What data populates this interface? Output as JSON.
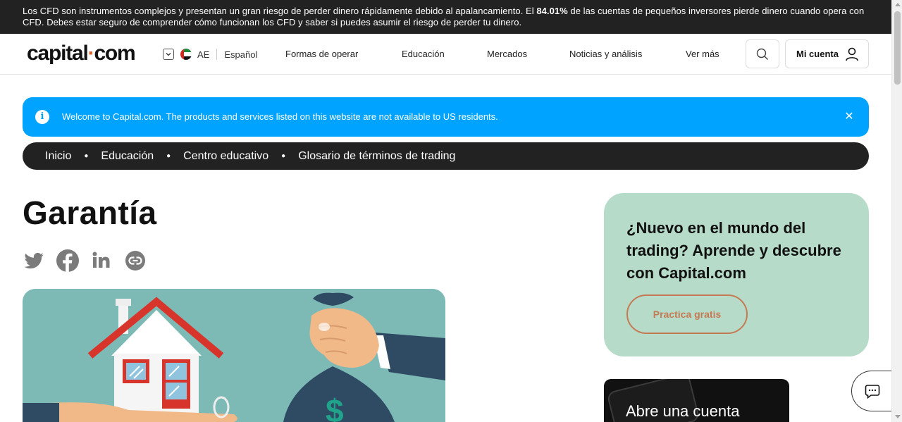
{
  "risk_warning": {
    "text_before": "Los CFD son instrumentos complejos y presentan un gran riesgo de perder dinero rápidamente debido al apalancamiento. El ",
    "percent": "84.01%",
    "text_after": " de las cuentas de pequeños inversores pierde dinero cuando opera con CFD. Debes estar seguro de comprender cómo funcionan los CFD y saber si puedes asumir el riesgo de perder tu dinero."
  },
  "header": {
    "logo_left": "capital",
    "logo_dot": "·",
    "logo_right": "com",
    "region": "AE",
    "language": "Español",
    "nav": [
      "Formas de operar",
      "Educación",
      "Mercados",
      "Noticias y análisis",
      "Ver más"
    ],
    "account_label": "Mi cuenta"
  },
  "alert": {
    "message": "Welcome to Capital.com. The products and services listed on this website are not available to US residents.",
    "close": "✕",
    "color": "#00a3ff"
  },
  "breadcrumb": [
    "Inicio",
    "Educación",
    "Centro educativo",
    "Glosario de términos de trading"
  ],
  "page": {
    "title": "Garantía"
  },
  "share_icons": [
    "twitter-icon",
    "facebook-icon",
    "linkedin-icon",
    "copy-link-icon"
  ],
  "promo": {
    "heading": "¿Nuevo en el mundo del trading? Aprende y descubre con Capital.com",
    "button": "Practica gratis",
    "background": "#b7dbc9",
    "accent": "#c47a53"
  },
  "account_card": {
    "label": "Abre una cuenta"
  }
}
